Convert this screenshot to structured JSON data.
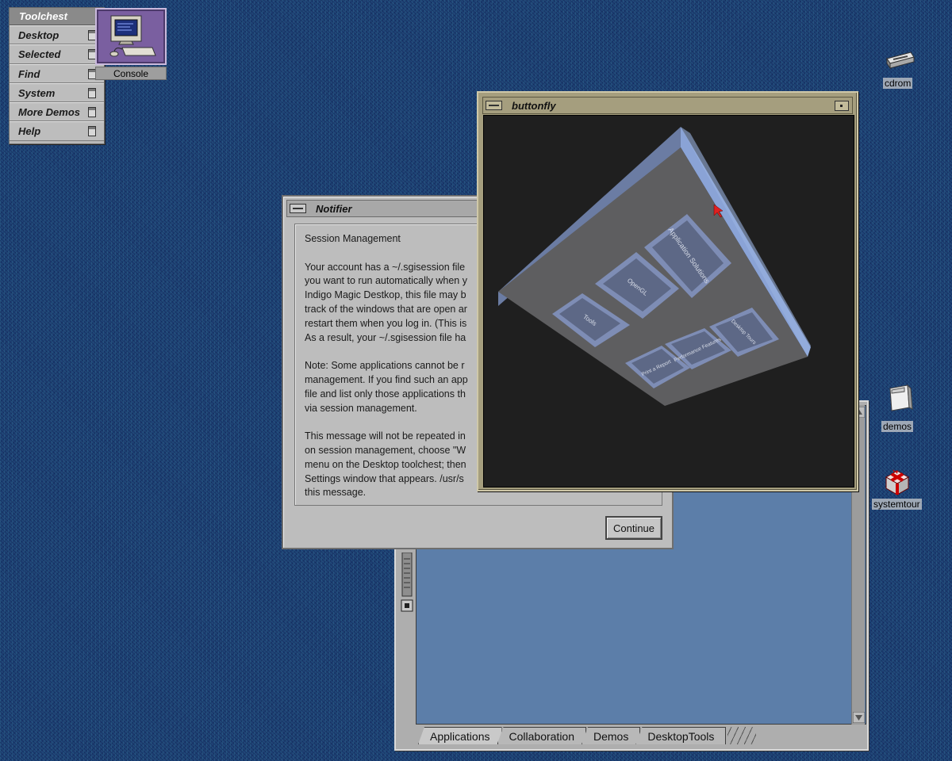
{
  "toolchest": {
    "title": "Toolchest",
    "items": [
      {
        "label": "Desktop"
      },
      {
        "label": "Selected"
      },
      {
        "label": "Find"
      },
      {
        "label": "System"
      },
      {
        "label": "More Demos"
      },
      {
        "label": "Help"
      }
    ]
  },
  "console": {
    "label": "Console"
  },
  "desktop_icons": {
    "cdrom": "cdrom",
    "demos": "demos",
    "systemtour": "systemtour"
  },
  "notifier": {
    "title": "Notifier",
    "heading": "Session Management",
    "para1": [
      "Your account has a ~/.sgisession file",
      "you want to run automatically when y",
      "Indigo Magic Destkop, this file may b",
      "track of the windows that are open ar",
      "restart them when you log in.  (This is",
      "As a result, your ~/.sgisession file ha"
    ],
    "para2": [
      "Note:  Some applications cannot be r",
      "management. If you find such an app",
      "file and list only those applications th",
      "via session management."
    ],
    "para3": [
      "This message will not be repeated in",
      "on session management, choose \"W",
      "menu on the Desktop toolchest; then",
      "Settings window that appears.  /usr/s",
      "this message."
    ],
    "continue_label": "Continue"
  },
  "buttonfly": {
    "title": "buttonfly",
    "buttons": [
      "Tools",
      "OpenGL",
      "Application Solutions",
      "Print a Report",
      "Performance Features",
      "Desktop Tours"
    ]
  },
  "file_window": {
    "tabs": [
      "Applications",
      "Collaboration",
      "Demos",
      "DesktopTools"
    ]
  },
  "colors": {
    "desktop": "#1f3d6e",
    "window_gray": "#bdbdbd",
    "buttonfly_frame": "#a59e7e",
    "panel_blue": "#5c7ea9"
  }
}
